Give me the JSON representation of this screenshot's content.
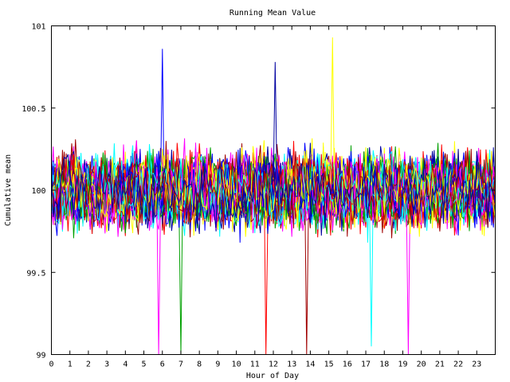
{
  "chart_data": {
    "type": "line",
    "title": "Running Mean Value",
    "xlabel": "Hour of Day",
    "ylabel": "Cumulative mean",
    "xlim": [
      0,
      24
    ],
    "ylim": [
      99,
      101
    ],
    "x_ticks": [
      0,
      1,
      2,
      3,
      4,
      5,
      6,
      7,
      8,
      9,
      10,
      11,
      12,
      13,
      14,
      15,
      16,
      17,
      18,
      19,
      20,
      21,
      22,
      23
    ],
    "x_tick_labels": [
      "0",
      "1",
      "2",
      "3",
      "4",
      "5",
      "6",
      "7",
      "8",
      "9",
      "10",
      "11",
      "12",
      "13",
      "14",
      "15",
      "16",
      "17",
      "18",
      "19",
      "20",
      "21",
      "22",
      "23"
    ],
    "y_ticks": [
      99,
      99.5,
      100,
      100.5,
      101
    ],
    "y_tick_labels": [
      "99",
      "99.5",
      "100",
      "100.5",
      "101"
    ],
    "grid": false,
    "legend": "none",
    "series_colors": [
      "#ff0000",
      "#00a000",
      "#0000ff",
      "#ff00ff",
      "#00ffff",
      "#ffff00",
      "#a00000",
      "#0000a0"
    ],
    "series_count": 48,
    "sample_step_hours": 0.1,
    "band_mean": 100.0,
    "band_halfwidth": 0.5,
    "spikes": [
      {
        "x": 5.8,
        "y": 99.0
      },
      {
        "x": 6.0,
        "y": 100.86
      },
      {
        "x": 7.0,
        "y": 99.0
      },
      {
        "x": 11.6,
        "y": 99.0
      },
      {
        "x": 12.1,
        "y": 100.78
      },
      {
        "x": 13.8,
        "y": 99.0
      },
      {
        "x": 15.2,
        "y": 100.93
      },
      {
        "x": 17.3,
        "y": 99.05
      },
      {
        "x": 19.3,
        "y": 99.0
      }
    ]
  }
}
